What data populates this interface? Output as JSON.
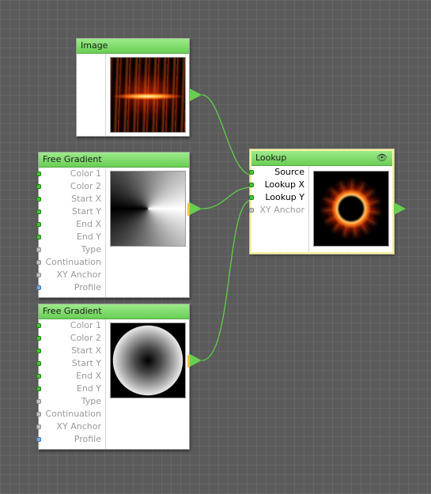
{
  "nodes": {
    "image": {
      "title": "Image"
    },
    "free_gradient_1": {
      "title": "Free Gradient",
      "ports": [
        {
          "label": "Color 1",
          "kind": "green"
        },
        {
          "label": "Color 2",
          "kind": "green"
        },
        {
          "label": "Start X",
          "kind": "green"
        },
        {
          "label": "Start Y",
          "kind": "green"
        },
        {
          "label": "End X",
          "kind": "green"
        },
        {
          "label": "End Y",
          "kind": "green"
        },
        {
          "label": "Type",
          "kind": "gray"
        },
        {
          "label": "Continuation",
          "kind": "gray"
        },
        {
          "label": "XY Anchor",
          "kind": "gray"
        },
        {
          "label": "Profile",
          "kind": "blue"
        }
      ]
    },
    "free_gradient_2": {
      "title": "Free Gradient",
      "ports": [
        {
          "label": "Color 1",
          "kind": "green"
        },
        {
          "label": "Color 2",
          "kind": "green"
        },
        {
          "label": "Start X",
          "kind": "green"
        },
        {
          "label": "Start Y",
          "kind": "green"
        },
        {
          "label": "End X",
          "kind": "green"
        },
        {
          "label": "End Y",
          "kind": "green"
        },
        {
          "label": "Type",
          "kind": "gray"
        },
        {
          "label": "Continuation",
          "kind": "gray"
        },
        {
          "label": "XY Anchor",
          "kind": "gray"
        },
        {
          "label": "Profile",
          "kind": "blue"
        }
      ]
    },
    "lookup": {
      "title": "Lookup",
      "eye_icon": "eye-icon",
      "ports": [
        {
          "label": "Source",
          "kind": "green",
          "connected": true
        },
        {
          "label": "Lookup X",
          "kind": "green",
          "connected": true
        },
        {
          "label": "Lookup Y",
          "kind": "green",
          "connected": true
        },
        {
          "label": "XY Anchor",
          "kind": "gray",
          "connected": false
        }
      ]
    }
  },
  "colors": {
    "canvas": "#5b5b5b",
    "title_bar": "#7ad964",
    "wire": "#63d24c",
    "selection": "#f3f1a6"
  }
}
